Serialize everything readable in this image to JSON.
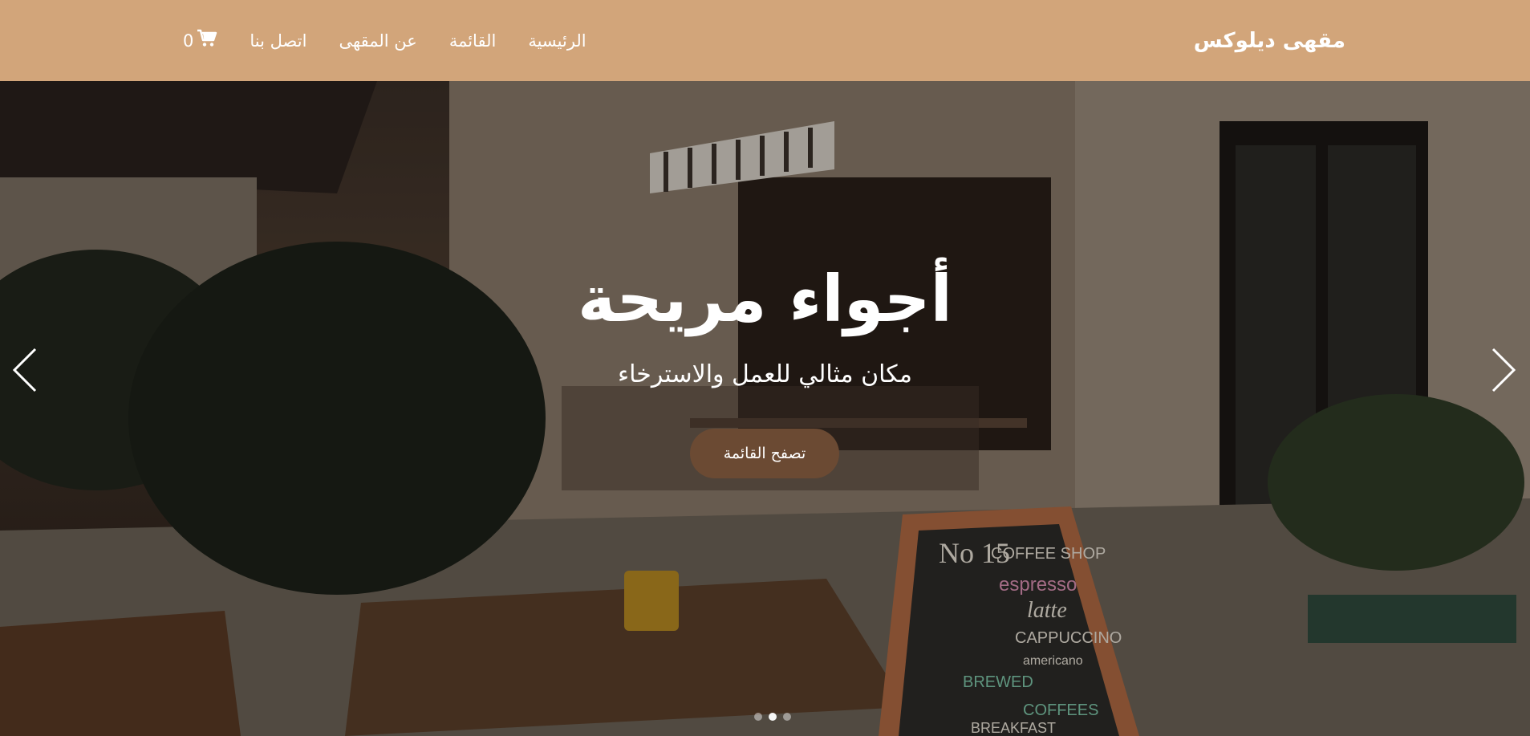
{
  "brand": {
    "name": "مقهى ديلوكس"
  },
  "nav": {
    "items": [
      "الرئيسية",
      "القائمة",
      "عن المقهى",
      "اتصل بنا"
    ],
    "cart_count": "0"
  },
  "hero": {
    "title": "أجواء مريحة",
    "subtitle": "مكان مثالي للعمل والاسترخاء",
    "cta_label": "تصفح القائمة",
    "slides": 3,
    "active_slide": 1,
    "sign_text": [
      "No 15",
      "COFFEE SHOP",
      "espresso",
      "latte",
      "CAPPUCCINO",
      "americano",
      "BREWED",
      "COFFEES",
      "BREAKFAST"
    ]
  },
  "colors": {
    "navbar": "#d2a57a",
    "cta": "#6b4a33",
    "text": "#ffffff"
  },
  "icons": {
    "cart": "cart-icon",
    "prev": "chevron-left-icon",
    "next": "chevron-right-icon"
  }
}
